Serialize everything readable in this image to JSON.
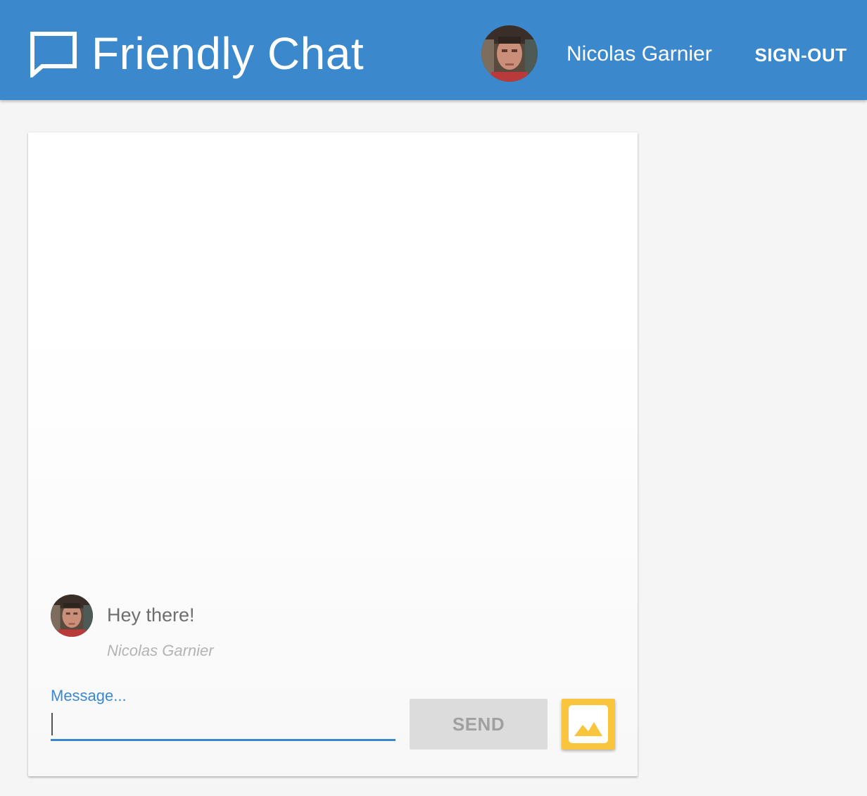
{
  "header": {
    "icon": "chat-bubble-icon",
    "title": "Friendly Chat",
    "user": {
      "name": "Nicolas Garnier",
      "avatar": "user-avatar"
    },
    "signout_label": "SIGN-OUT"
  },
  "messages": [
    {
      "text": "Hey there!",
      "author": "Nicolas Garnier",
      "avatar": "user-avatar"
    }
  ],
  "composer": {
    "label": "Message...",
    "value": "",
    "send_label": "SEND",
    "image_icon": "image-icon"
  },
  "colors": {
    "header": "#3b89cc",
    "accent": "#3b89cc",
    "image_button": "#f8c53c",
    "send_disabled": "#dcdcdc",
    "background": "#f5f5f5"
  }
}
